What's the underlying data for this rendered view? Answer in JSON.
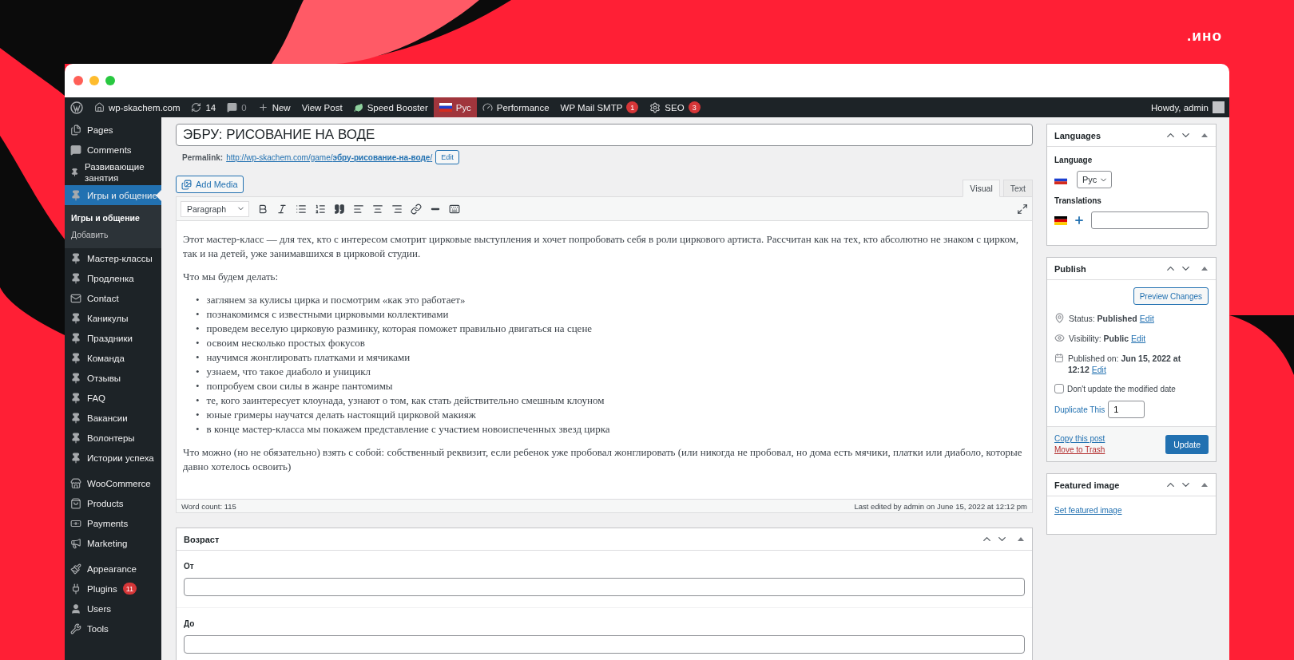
{
  "logo": ".ино",
  "browser": {
    "controls": [
      {
        "color": "#ff5f57"
      },
      {
        "color": "#febc2e"
      },
      {
        "color": "#28c840"
      }
    ]
  },
  "admin_bar": {
    "items": [
      {
        "kind": "wp"
      },
      {
        "kind": "site",
        "label": "wp-skachem.com"
      },
      {
        "kind": "updates",
        "label": "14"
      },
      {
        "kind": "comments",
        "label": "0"
      },
      {
        "kind": "new",
        "label": "New"
      },
      {
        "kind": "text",
        "label": "View Post"
      },
      {
        "kind": "speed",
        "label": "Speed Booster"
      },
      {
        "kind": "language",
        "label": "Рус"
      },
      {
        "kind": "performance",
        "label": "Performance"
      },
      {
        "kind": "text",
        "label": "WP Mail SMTP",
        "badge": "1"
      },
      {
        "kind": "seo",
        "label": "SEO",
        "badge": "3"
      }
    ],
    "account": "Howdy, admin"
  },
  "sidebar": {
    "groups": [
      [
        {
          "kind": "pages",
          "label": "Pages",
          "selected": false
        },
        {
          "kind": "comments",
          "label": "Comments",
          "selected": false
        },
        {
          "kind": "pin",
          "label": "Развивающие занятия",
          "selected": false
        },
        {
          "kind": "pin",
          "label": "Игры и общение",
          "selected": true,
          "children": [
            {
              "label": "Игры и общение",
              "selected": true
            },
            {
              "label": "Добавить",
              "selected": false
            }
          ]
        },
        {
          "kind": "pin",
          "label": "Мастер-классы",
          "selected": false
        },
        {
          "kind": "pin",
          "label": "Продленка",
          "selected": false
        },
        {
          "kind": "mail",
          "label": "Contact",
          "selected": false
        },
        {
          "kind": "pin",
          "label": "Каникулы",
          "selected": false
        },
        {
          "kind": "pin",
          "label": "Праздники",
          "selected": false
        },
        {
          "kind": "pin",
          "label": "Команда",
          "selected": false
        },
        {
          "kind": "pin",
          "label": "Отзывы",
          "selected": false
        },
        {
          "kind": "pin",
          "label": "FAQ",
          "selected": false
        },
        {
          "kind": "pin",
          "label": "Вакансии",
          "selected": false
        },
        {
          "kind": "pin",
          "label": "Волонтеры",
          "selected": false
        },
        {
          "kind": "pin",
          "label": "Истории успеха",
          "selected": false
        }
      ],
      [
        {
          "kind": "woo",
          "label": "WooCommerce",
          "selected": false
        },
        {
          "kind": "products",
          "label": "Products",
          "selected": false
        },
        {
          "kind": "payments",
          "label": "Payments",
          "selected": false
        },
        {
          "kind": "marketing",
          "label": "Marketing",
          "selected": false
        }
      ],
      [
        {
          "kind": "appearance",
          "label": "Appearance",
          "selected": false
        },
        {
          "kind": "plugins",
          "label": "Plugins",
          "badge": "11",
          "selected": false
        },
        {
          "kind": "users",
          "label": "Users",
          "selected": false
        },
        {
          "kind": "tools",
          "label": "Tools",
          "selected": false
        }
      ]
    ]
  },
  "editor": {
    "title": "ЭБРУ: РИСОВАНИЕ НА ВОДЕ",
    "permalink": {
      "label": "Permalink:",
      "url": "http://wp-skachem.com/game/**эбру-рисование-на-воде**/",
      "edit": "Edit"
    },
    "add_media": "Add Media",
    "tabs": [
      {
        "label": "Visual",
        "selected": true
      },
      {
        "label": "Text",
        "selected": false
      }
    ],
    "format": "Paragraph",
    "toolbar": [
      {
        "kind": "bold"
      },
      {
        "kind": "italic"
      },
      {
        "kind": "bullets"
      },
      {
        "kind": "numbers"
      },
      {
        "kind": "quote"
      },
      {
        "kind": "align-left"
      },
      {
        "kind": "align-center"
      },
      {
        "kind": "align-right"
      },
      {
        "kind": "link"
      },
      {
        "kind": "more"
      },
      {
        "kind": "keyboard"
      }
    ],
    "content": [
      {
        "kind": "paragraph",
        "text": "Этот мастер-класс — для тех, кто с интересом смотрит цирковые выступления и хочет попробовать себя в роли циркового артиста. Рассчитан как на тех, кто абсолютно не знаком с цирком, так и на детей, уже занимавшихся в цирковой студии."
      },
      {
        "kind": "paragraph",
        "text": "Что мы будем делать:"
      },
      {
        "kind": "list",
        "marker": "•",
        "items": [
          "заглянем за кулисы цирка и посмотрим «как это работает»",
          "познакомимся с известными цирковыми коллективами",
          "проведем веселую цирковую разминку, которая поможет правильно двигаться на сцене",
          "освоим несколько простых фокусов",
          "научимся жонглировать платками и мячиками",
          "узнаем, что такое диаболо и уницикл",
          "попробуем свои силы в жанре пантомимы",
          "те, кого заинтересует клоунада, узнают о том, как стать действительно смешным клоуном",
          "юные гримеры научатся делать настоящий цирковой макияж",
          "в конце мастер-класса мы покажем представление с участием новоиспеченных звезд цирка"
        ]
      },
      {
        "kind": "paragraph",
        "text": "Что можно (но не обязательно) взять с собой: собственный реквизит, если ребенок уже пробовал жонглировать (или никогда не пробовал, но дома есть мячики, платки или диаболо, которые давно хотелось освоить)"
      }
    ],
    "word_count": "Word count: 115",
    "last_edited": "Last edited by admin on June 15, 2022 at 12:12 pm"
  },
  "age_box": {
    "title": "Возраст",
    "fields": [
      {
        "label": "От"
      },
      {
        "label": "До"
      }
    ]
  },
  "languages_box": {
    "title": "Languages",
    "language_label": "Language",
    "language": "Рус",
    "translations_label": "Translations"
  },
  "publish_box": {
    "title": "Publish",
    "preview": "Preview Changes",
    "rows": [
      {
        "kind": "status",
        "text": "Status: **Published**",
        "link": "Edit"
      },
      {
        "kind": "visibility",
        "text": "Visibility: **Public**",
        "link": "Edit"
      },
      {
        "kind": "date",
        "text": "Published on: **Jun 15, 2022 at 12:12**",
        "link": "Edit"
      }
    ],
    "checkbox": {
      "label": "Don't update the modified date",
      "checked": false
    },
    "duplicate": {
      "label": "Duplicate This",
      "value": "1"
    },
    "copy": "Copy this post",
    "trash": "Move to Trash",
    "update": "Update"
  },
  "featured_box": {
    "title": "Featured image",
    "link": "Set featured image"
  }
}
